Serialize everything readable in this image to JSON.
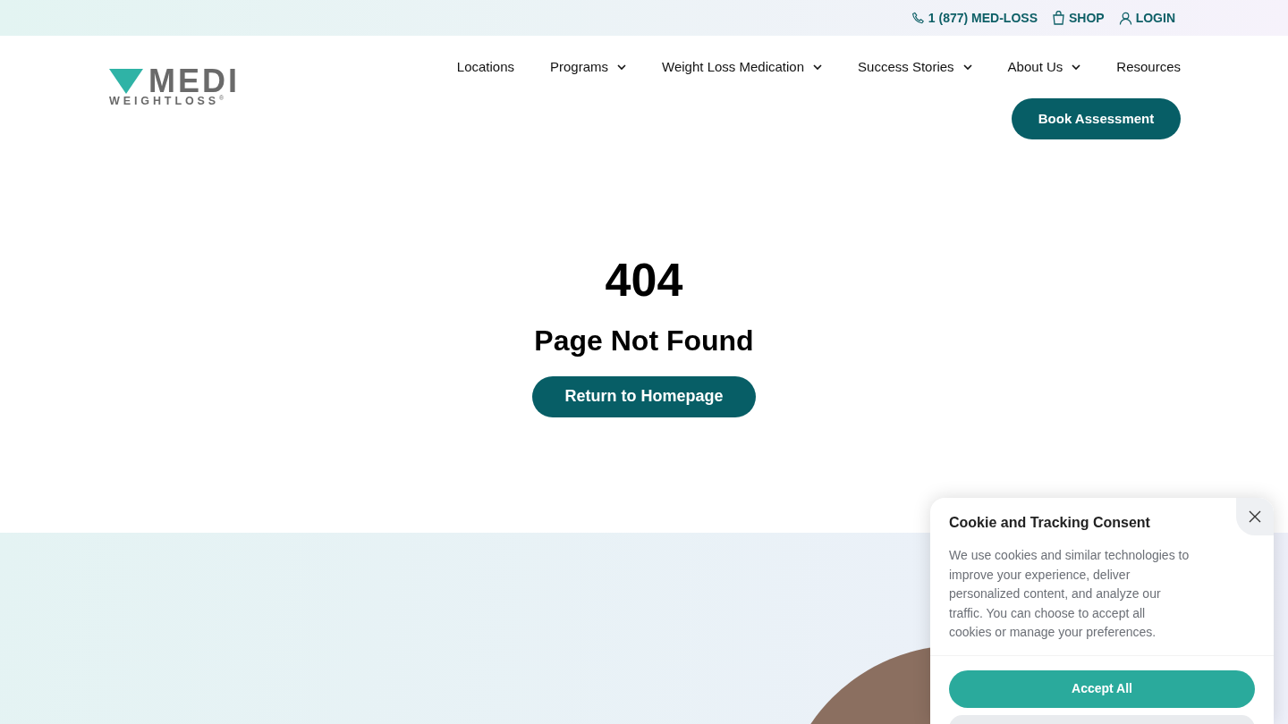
{
  "top_bar": {
    "links": [
      {
        "kind": "phone",
        "label": "1 (877) MED-LOSS"
      },
      {
        "kind": "shop",
        "label": "SHOP"
      },
      {
        "kind": "login",
        "label": "LOGIN"
      }
    ]
  },
  "logo": {
    "word": "MEDI",
    "subword": "WEIGHTLOSS",
    "mark": "®"
  },
  "nav": {
    "items": [
      {
        "label": "Locations",
        "dropdown": false
      },
      {
        "label": "Programs",
        "dropdown": true
      },
      {
        "label": "Weight Loss Medication",
        "dropdown": true
      },
      {
        "label": "Success Stories",
        "dropdown": true
      },
      {
        "label": "About Us",
        "dropdown": true
      },
      {
        "label": "Resources",
        "dropdown": false
      }
    ],
    "cta": "Book Assessment"
  },
  "error": {
    "code": "404",
    "title": "Page Not Found",
    "button": "Return to Homepage"
  },
  "cookie_panel": {
    "title": "Cookie and Tracking Consent",
    "text": "We use cookies and similar technologies to improve your experience, deliver personalized content, and analyze our traffic. You can choose to accept all cookies or manage your preferences.",
    "accept": "Accept All"
  }
}
